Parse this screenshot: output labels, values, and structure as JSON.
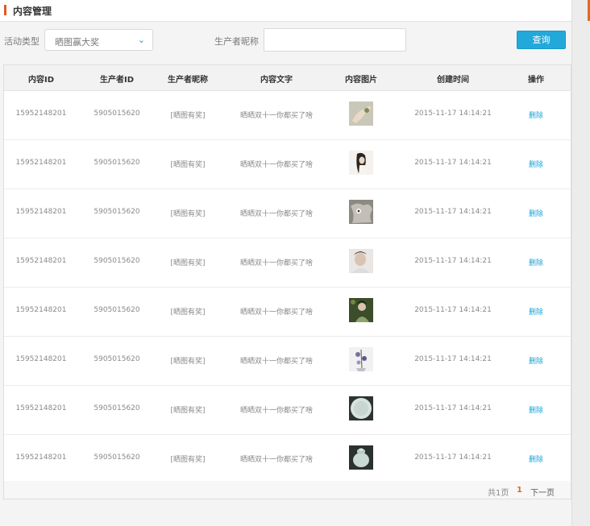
{
  "header": {
    "title": "内容管理"
  },
  "filter": {
    "type_label": "活动类型",
    "type_value": "晒图赢大奖",
    "nickname_label": "生产者昵称",
    "nickname_value": "",
    "search_label": "查询"
  },
  "table": {
    "columns": [
      "内容ID",
      "生产者ID",
      "生产者昵称",
      "内容文字",
      "内容图片",
      "创建时间",
      "操作"
    ],
    "rows": [
      {
        "content_id": "15952148201",
        "producer_id": "5905015620",
        "nickname": "[晒图有奖]",
        "text": "晒晒双十一你都买了啥",
        "time": "2015-11-17  14:14:21",
        "action": "删除",
        "img": "hand"
      },
      {
        "content_id": "15952148201",
        "producer_id": "5905015620",
        "nickname": "[晒图有奖]",
        "text": "晒晒双十一你都买了啥",
        "time": "2015-11-17  14:14:21",
        "action": "删除",
        "img": "woman"
      },
      {
        "content_id": "15952148201",
        "producer_id": "5905015620",
        "nickname": "[晒图有奖]",
        "text": "晒晒双十一你都买了啥",
        "time": "2015-11-17  14:14:21",
        "action": "删除",
        "img": "fur"
      },
      {
        "content_id": "15952148201",
        "producer_id": "5905015620",
        "nickname": "[晒图有奖]",
        "text": "晒晒双十一你都买了啥",
        "time": "2015-11-17  14:14:21",
        "action": "删除",
        "img": "portrait"
      },
      {
        "content_id": "15952148201",
        "producer_id": "5905015620",
        "nickname": "[晒图有奖]",
        "text": "晒晒双十一你都买了啥",
        "time": "2015-11-17  14:14:21",
        "action": "删除",
        "img": "green"
      },
      {
        "content_id": "15952148201",
        "producer_id": "5905015620",
        "nickname": "[晒图有奖]",
        "text": "晒晒双十一你都买了啥",
        "time": "2015-11-17  14:14:21",
        "action": "删除",
        "img": "flowers"
      },
      {
        "content_id": "15952148201",
        "producer_id": "5905015620",
        "nickname": "[晒图有奖]",
        "text": "晒晒双十一你都买了啥",
        "time": "2015-11-17  14:14:21",
        "action": "删除",
        "img": "plate"
      },
      {
        "content_id": "15952148201",
        "producer_id": "5905015620",
        "nickname": "[晒图有奖]",
        "text": "晒晒双十一你都买了啥",
        "time": "2015-11-17  14:14:21",
        "action": "删除",
        "img": "jar"
      }
    ]
  },
  "pager": {
    "total": "共1页",
    "current": "1",
    "next": "下一页"
  }
}
